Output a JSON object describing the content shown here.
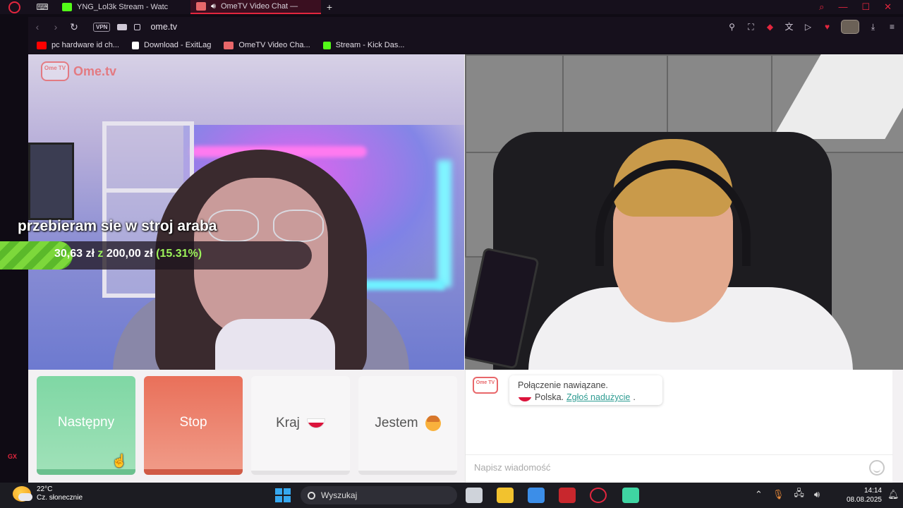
{
  "browser": {
    "tabs": [
      {
        "label": "YNG_Lol3k Stream - Watc",
        "favicon_color": "#53fc18"
      },
      {
        "label": "OmeTV Video Chat —",
        "favicon_color": "#e8676a"
      }
    ],
    "new_tab": "+",
    "url": "ome.tv",
    "vpn_label": "VPN",
    "bookmarks": [
      {
        "label": "pc hardware id ch...",
        "favicon_color": "#ff0000"
      },
      {
        "label": "Download - ExitLag",
        "favicon_color": "#ffffff"
      },
      {
        "label": "OmeTV Video Cha...",
        "favicon_color": "#e8676a"
      },
      {
        "label": "Stream - Kick Das...",
        "favicon_color": "#53fc18"
      }
    ],
    "sidebar": {
      "gx": "GX",
      "more": "···"
    }
  },
  "site": {
    "logo_badge": "Ome TV",
    "logo_text": "Ome.tv"
  },
  "stream_overlay": {
    "title": "przebieram sie w stroj araba",
    "current": "30,63 zł",
    "separator": "z",
    "target": "200,00 zł",
    "percent_label": "(15.31%)",
    "progress": 0.1531
  },
  "controls": {
    "next": "Następny",
    "stop": "Stop",
    "country": "Kraj",
    "gender": "Jestem"
  },
  "chat": {
    "logo_badge": "Ome TV",
    "status": "Połączenie nawiązane.",
    "country": "Polska.",
    "report": "Zgłoś nadużycie",
    "report_suffix": ".",
    "placeholder": "Napisz wiadomość"
  },
  "taskbar": {
    "temperature": "22°C",
    "weather": "Cz. słonecznie",
    "search": "Wyszukaj",
    "time": "14:14",
    "date": "08.08.2025"
  }
}
